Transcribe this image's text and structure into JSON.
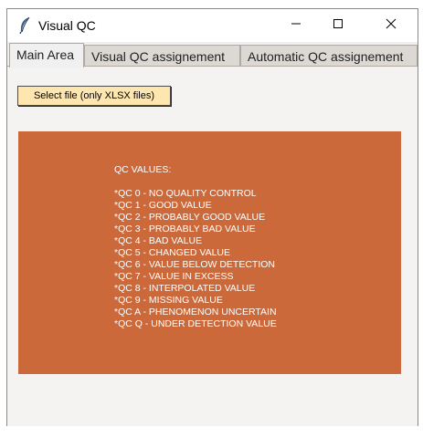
{
  "window": {
    "title": "Visual QC",
    "icon": "feather-icon",
    "controls": [
      "minimize-icon",
      "maximize-icon",
      "close-icon"
    ]
  },
  "tabs": [
    {
      "label": "Main Area",
      "active": true
    },
    {
      "label": "Visual QC assignement",
      "active": false
    },
    {
      "label": "Automatic QC assignement",
      "active": false
    }
  ],
  "main": {
    "file_button_label": "Select file (only XLSX files)",
    "panel_color": "#cc693b",
    "qc_heading": "QC VALUES:",
    "qc_values": [
      "*QC 0 - NO QUALITY CONTROL",
      "*QC 1 - GOOD VALUE",
      "*QC 2 - PROBABLY GOOD VALUE",
      "*QC 3 - PROBABLY BAD VALUE",
      "*QC 4 - BAD VALUE",
      "*QC 5 - CHANGED VALUE",
      "*QC 6 - VALUE BELOW DETECTION",
      "*QC 7 - VALUE IN EXCESS",
      "*QC 8 - INTERPOLATED VALUE",
      "*QC 9 - MISSING VALUE",
      "*QC A - PHENOMENON UNCERTAIN",
      "*QC Q - UNDER DETECTION VALUE"
    ]
  }
}
